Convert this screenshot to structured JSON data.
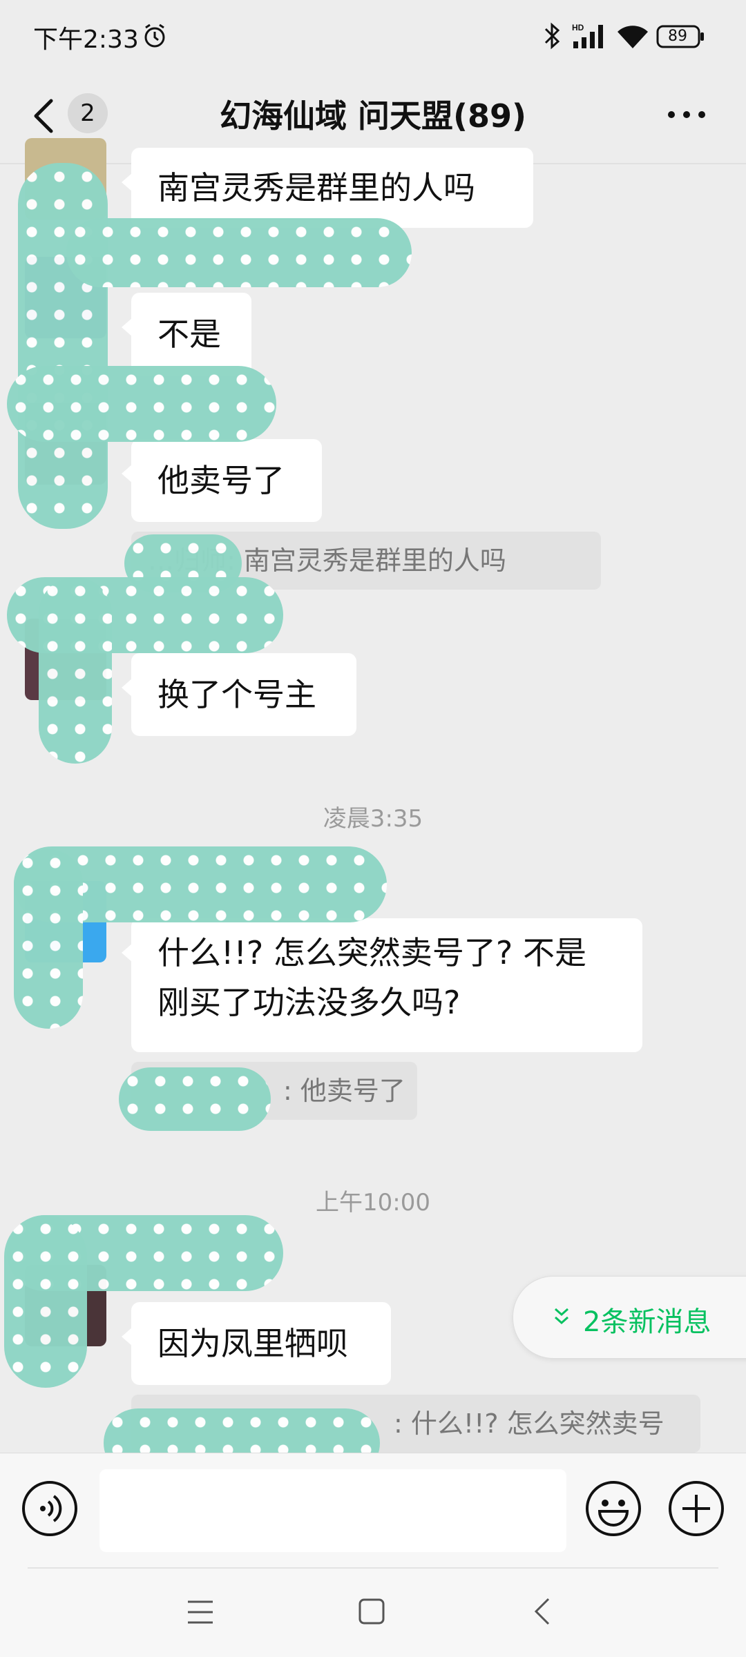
{
  "status_bar": {
    "time": "下午2:33",
    "battery": "89"
  },
  "header": {
    "back_badge": "2",
    "title": "幻海仙域 问天盟(89)"
  },
  "messages": [
    {
      "text": "南宫灵秀是群里的人吗"
    },
    {
      "text": "不是"
    },
    {
      "text": "他卖号了",
      "quote": "…归师: 南宫灵秀是群里的人吗"
    },
    {
      "text": "换了个号主"
    },
    {
      "timestamp": "凌晨3:35"
    },
    {
      "text_line1": "什么!!? 怎么突然卖号了? 不是",
      "text_line2": "刚买了功法没多久吗?",
      "quote": ": 他卖号了"
    },
    {
      "timestamp": "上午10:00"
    },
    {
      "text": "因为凤里牺呗",
      "quote": ": 什么!!? 怎么突然卖号"
    }
  ],
  "new_messages": {
    "label": "2条新消息",
    "color": "#07c160"
  },
  "input_bar": {
    "placeholder": ""
  },
  "colors": {
    "background": "#ededed",
    "bubble": "#ffffff",
    "accent": "#07c160",
    "censor": "#8fd6c5"
  }
}
